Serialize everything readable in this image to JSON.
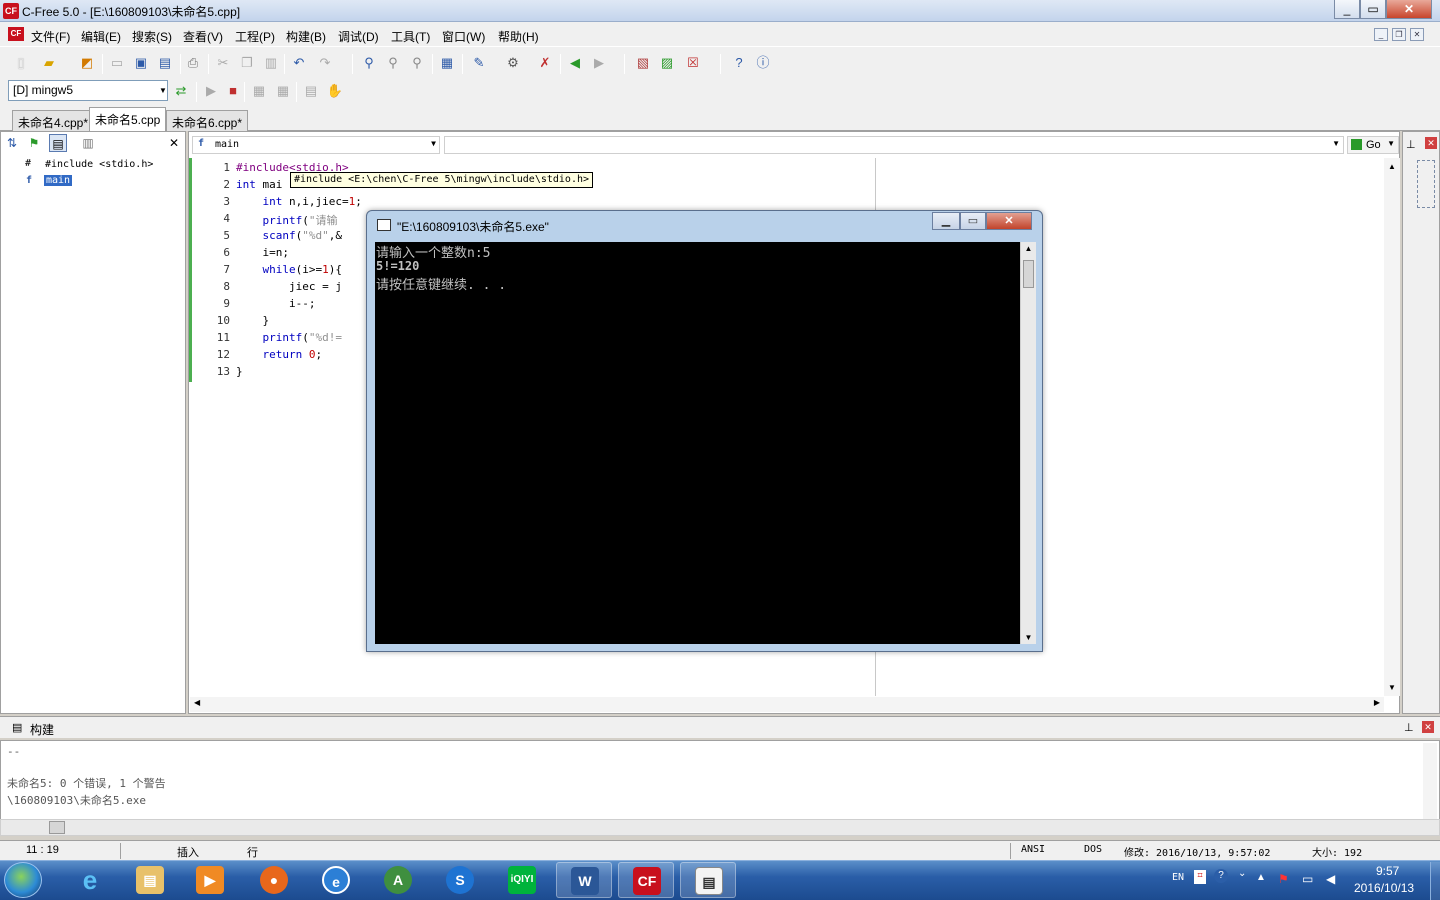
{
  "window": {
    "title": "C-Free 5.0 - [E:\\160809103\\未命名5.cpp]",
    "app_icon": "C-Free",
    "buttons": [
      "minimize-icon",
      "maximize-icon",
      "close-icon"
    ]
  },
  "menubar": {
    "items": [
      "文件(F)",
      "编辑(E)",
      "搜索(S)",
      "查看(V)",
      "工程(P)",
      "构建(B)",
      "调试(D)",
      "工具(T)",
      "窗口(W)",
      "帮助(H)"
    ]
  },
  "toolbar": {
    "compiler": "[D] mingw5",
    "go_label": "Go"
  },
  "tabs": [
    "未命名4.cpp*",
    "未命名5.cpp",
    "未命名6.cpp*"
  ],
  "class_tree": {
    "include": "#include <stdio.h>",
    "function": "main"
  },
  "editor": {
    "function_combo": "main",
    "line_numbers": [
      "1",
      "2",
      "3",
      "4",
      "5",
      "6",
      "7",
      "8",
      "9",
      "10",
      "11",
      "12",
      "13"
    ],
    "tooltip": "#include <E:\\chen\\C-Free 5\\mingw\\include\\stdio.h>"
  },
  "console": {
    "title": "\"E:\\160809103\\未命名5.exe\"",
    "lines": [
      "请输入一个整数n:5",
      "5!=120",
      "请按任意键继续. . ."
    ]
  },
  "build": {
    "header": "构建",
    "lines": [
      "--",
      "",
      "未命名5: 0 个错误, 1 个警告",
      "\\160809103\\未命名5.exe"
    ]
  },
  "status": {
    "position": "11 : 19",
    "mode": "插入",
    "line_mode": "行",
    "encoding": "ANSI",
    "line_ending": "DOS",
    "modified": "修改: 2016/10/13, 9:57:02",
    "size": "大小: 192"
  },
  "taskbar": {
    "language": "EN",
    "time": "9:57",
    "date": "2016/10/13"
  },
  "colors": {
    "keyword": "#0000c0",
    "string": "#909090",
    "number": "#c00000",
    "modified_bar": "#4caf50"
  }
}
